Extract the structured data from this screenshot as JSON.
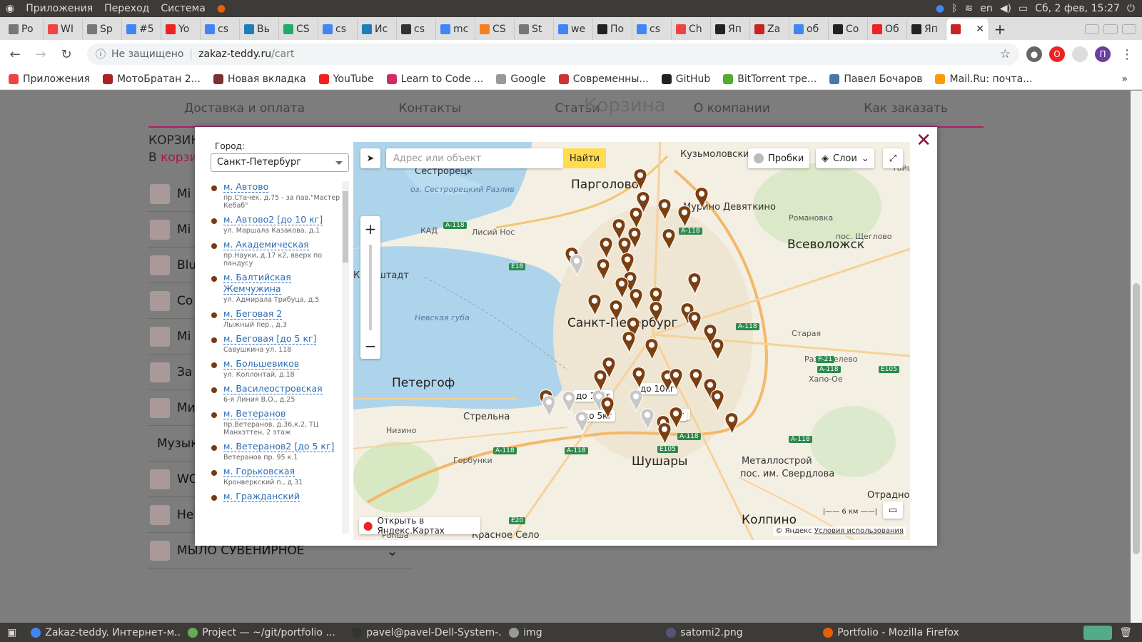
{
  "system": {
    "menus": [
      "Приложения",
      "Переход",
      "Система"
    ],
    "lang": "en",
    "clock": "Сб, 2 фев, 15:27"
  },
  "tabs": [
    {
      "label": "Po",
      "icon": "page-icon",
      "color": "#777"
    },
    {
      "label": "WI",
      "icon": "o-icon",
      "color": "#e44"
    },
    {
      "label": "Sp",
      "icon": "page-icon",
      "color": "#777"
    },
    {
      "label": "#5",
      "icon": "google-icon",
      "color": "#4285f4"
    },
    {
      "label": "Yo",
      "icon": "youtube-icon",
      "color": "#e22"
    },
    {
      "label": "cs",
      "icon": "google-icon",
      "color": "#4285f4"
    },
    {
      "label": "Вь",
      "icon": "eye-icon",
      "color": "#1d7fb8"
    },
    {
      "label": "CS",
      "icon": "h-icon",
      "color": "#2a6"
    },
    {
      "label": "cs",
      "icon": "google-icon",
      "color": "#4285f4"
    },
    {
      "label": "Ис",
      "icon": "eye-icon",
      "color": "#1d7fb8"
    },
    {
      "label": "cs",
      "icon": "glasses-icon",
      "color": "#333"
    },
    {
      "label": "mc",
      "icon": "google-icon",
      "color": "#4285f4"
    },
    {
      "label": "CS",
      "icon": "stack-icon",
      "color": "#f48024"
    },
    {
      "label": "St",
      "icon": "page-icon",
      "color": "#777"
    },
    {
      "label": "we",
      "icon": "google-icon",
      "color": "#4285f4"
    },
    {
      "label": "По",
      "icon": "t-icon",
      "color": "#222"
    },
    {
      "label": "cs",
      "icon": "google-icon",
      "color": "#4285f4"
    },
    {
      "label": "Ch",
      "icon": "chrome-icon",
      "color": "#e44"
    },
    {
      "label": "Яп",
      "icon": "kanji-icon",
      "color": "#222"
    },
    {
      "label": "Za",
      "icon": "thumb-icon",
      "color": "#c22"
    },
    {
      "label": "об",
      "icon": "google-icon",
      "color": "#4285f4"
    },
    {
      "label": "Co",
      "icon": "box-icon",
      "color": "#222"
    },
    {
      "label": "Об",
      "icon": "arrow-icon",
      "color": "#e22"
    },
    {
      "label": "Яп",
      "icon": "kanji-icon",
      "color": "#222"
    }
  ],
  "active_tab_close": "✕",
  "address": {
    "security": "Не защищено",
    "host": "zakaz-teddy.ru",
    "path": "/cart"
  },
  "bookmarks": [
    {
      "label": "Приложения",
      "color": "#e44"
    },
    {
      "label": "МотоБратан 2...",
      "color": "#a22"
    },
    {
      "label": "Новая вкладка",
      "color": "#733"
    },
    {
      "label": "YouTube",
      "color": "#e22"
    },
    {
      "label": "Learn to Code ...",
      "color": "#d22b6a"
    },
    {
      "label": "Google",
      "color": "#999"
    },
    {
      "label": "Современны...",
      "color": "#c33"
    },
    {
      "label": "GitHub",
      "color": "#222"
    },
    {
      "label": "BitTorrent тре...",
      "color": "#5a3"
    },
    {
      "label": "Павел Бочаров",
      "color": "#4a76a8"
    },
    {
      "label": "Mail.Ru: почта...",
      "color": "#f90"
    }
  ],
  "site": {
    "nav": [
      "Доставка и оплата",
      "Контакты",
      "Статьи",
      "О компании",
      "Как заказать"
    ],
    "ghost_title": "Корзина",
    "cart_heading": "КОРЗИН",
    "cart_sub_prefix": "В ",
    "cart_sub_link": "корзи",
    "products": [
      "Mi",
      "Mi",
      "Blu",
      "Co",
      "Mi",
      "За",
      "Ми",
      "Музык",
      "WO",
      "Hell",
      "МЫЛО СУВЕНИРНОЕ"
    ]
  },
  "modal": {
    "close": "✕",
    "city_label": "Город:",
    "city_value": "Санкт-Петербург",
    "points": [
      {
        "title": "м. Автово",
        "addr": "пр.Стачек, д.75 - за пав.\"Мастер Кебаб\""
      },
      {
        "title": "м. Автово2 [до 10 кг]",
        "addr": "ул. Маршала Казакова, д.1"
      },
      {
        "title": "м. Академическая",
        "addr": "пр.Науки, д.17 к2, вверх по пандусу"
      },
      {
        "title": "м. Балтийская Жемчужина",
        "addr": "ул. Адмирала Трибуца, д.5"
      },
      {
        "title": "м. Беговая 2",
        "addr": "Лыжный пер., д.3"
      },
      {
        "title": "м. Беговая [до 5 кг]",
        "addr": "Савушкина ул. 118"
      },
      {
        "title": "м. Большевиков",
        "addr": "ул. Коллонтай, д.18"
      },
      {
        "title": "м. Василеостровская",
        "addr": "6-я Линия В.О., д.25"
      },
      {
        "title": "м. Ветеранов",
        "addr": "пр.Ветеранов, д.36,к.2, ТЦ Манхэттен, 2 этаж"
      },
      {
        "title": "м. Ветеранов2 [до 5 кг]",
        "addr": "Ветеранов пр. 95 к.1"
      },
      {
        "title": "м. Горьковская",
        "addr": "Кронверкский п., д.31"
      },
      {
        "title": "м. Гражданский",
        "addr": ""
      }
    ],
    "map": {
      "search_placeholder": "Адрес или объект",
      "find": "Найти",
      "traffic": "Пробки",
      "layers": "Слои",
      "open_yandex": "Открыть в Яндекс.Картах",
      "copyright": "© Яндекс",
      "terms": "Условия использования",
      "scale": "6 км",
      "labels": [
        {
          "t": "Кузьмоловский",
          "cls": ""
        },
        {
          "t": "Сестрорецк",
          "cls": ""
        },
        {
          "t": "Парголово",
          "cls": "big"
        },
        {
          "t": "Девяткино",
          "cls": ""
        },
        {
          "t": "Мурино",
          "cls": ""
        },
        {
          "t": "Романовка",
          "cls": "sm"
        },
        {
          "t": "пос. Щеглово",
          "cls": "sm"
        },
        {
          "t": "Всеволожск",
          "cls": "big"
        },
        {
          "t": "оз. Сестрорецкий Разлив",
          "cls": "water"
        },
        {
          "t": "Лисий Нос",
          "cls": "sm"
        },
        {
          "t": "КАД",
          "cls": "sm"
        },
        {
          "t": "Кронштадт",
          "cls": ""
        },
        {
          "t": "Невская губа",
          "cls": "water"
        },
        {
          "t": "Санкт-Петербург",
          "cls": "big"
        },
        {
          "t": "Старая",
          "cls": "sm"
        },
        {
          "t": "Разметелево",
          "cls": "sm"
        },
        {
          "t": "Хапо-Ое",
          "cls": "sm"
        },
        {
          "t": "Петергоф",
          "cls": "big"
        },
        {
          "t": "Стрельна",
          "cls": ""
        },
        {
          "t": "Низино",
          "cls": "sm"
        },
        {
          "t": "Горбунки",
          "cls": "sm"
        },
        {
          "t": "Шушары",
          "cls": "big"
        },
        {
          "t": "Металлострой",
          "cls": ""
        },
        {
          "t": "пос. им. Свердлова",
          "cls": ""
        },
        {
          "t": "Отрадное",
          "cls": ""
        },
        {
          "t": "Колпино",
          "cls": "big"
        },
        {
          "t": "Ропша",
          "cls": "sm"
        },
        {
          "t": "Красное Село",
          "cls": ""
        },
        {
          "t": "Тайцы",
          "cls": "sm"
        }
      ],
      "tags": [
        "до 10кг",
        "до 10кг",
        "до 5кг",
        "кг",
        "кг"
      ],
      "road_badges": [
        "А-118",
        "А-118",
        "А-118",
        "А-118",
        "А-118",
        "А-118",
        "А-118",
        "E18",
        "E105",
        "E105",
        "E20",
        "Р-21",
        "А-118"
      ],
      "pin_colors": {
        "brown": "#7b3f12",
        "gray": "#c8c8c8"
      }
    }
  },
  "taskbar": [
    {
      "label": "Zakaz-teddy. Интернет-м...",
      "color": "#4285f4"
    },
    {
      "label": "Project — ~/git/portfolio ...",
      "color": "#6a5"
    },
    {
      "label": "pavel@pavel-Dell-System-...",
      "color": "#333"
    },
    {
      "label": "img",
      "color": "#999"
    },
    {
      "label": "satomi2.png",
      "color": "#557"
    },
    {
      "label": "Portfolio - Mozilla Firefox",
      "color": "#e66000"
    }
  ]
}
